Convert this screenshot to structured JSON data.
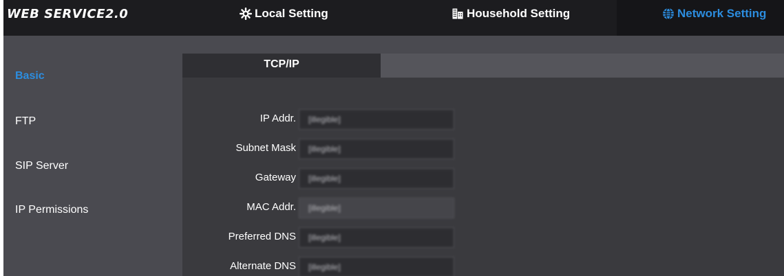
{
  "header": {
    "brand": "WEB SERVICE2.0",
    "nav": [
      {
        "label": "Local Setting",
        "icon": "gear-icon"
      },
      {
        "label": "Household Setting",
        "icon": "building-icon"
      },
      {
        "label": "Network Setting",
        "icon": "globe-icon",
        "active": true
      }
    ],
    "accent_color": "#2c8ddf"
  },
  "sidebar": {
    "items": [
      {
        "label": "Basic",
        "active": true
      },
      {
        "label": "FTP"
      },
      {
        "label": "SIP Server"
      },
      {
        "label": "IP Permissions"
      }
    ]
  },
  "main": {
    "tab": "TCP/IP",
    "fields": [
      {
        "label": "IP Addr.",
        "value": "[illegible]"
      },
      {
        "label": "Subnet Mask",
        "value": "[illegible]"
      },
      {
        "label": "Gateway",
        "value": "[illegible]"
      },
      {
        "label": "MAC Addr.",
        "value": "[illegible]",
        "readonly": true
      },
      {
        "label": "Preferred DNS",
        "value": "[illegible]"
      },
      {
        "label": "Alternate DNS",
        "value": "[illegible]"
      }
    ]
  }
}
